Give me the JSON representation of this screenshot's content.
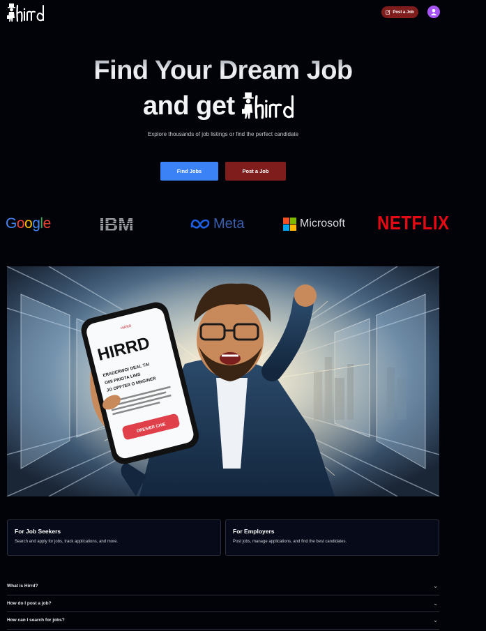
{
  "header": {
    "logo_text": "Hird",
    "post_job_label": "Post a Job"
  },
  "hero": {
    "line1": "Find Your Dream Job",
    "line2_prefix": "and get",
    "logo_text": "Hird",
    "subtitle": "Explore thousands of job listings or find the perfect candidate",
    "find_jobs_label": "Find Jobs",
    "post_job_label": "Post a Job"
  },
  "companies": [
    "Google",
    "IBM",
    "Meta",
    "Microsoft",
    "NETFLIX"
  ],
  "banner": {
    "phone_title": "HIRRD",
    "phone_small": "HIRRD",
    "phone_line1": "ERADERWO! DEAL TAI",
    "phone_line2": "OIIII PRIOTA LIMS",
    "phone_line3": "JO OPFTER O MNGINER",
    "phone_button": "DRESIER CHIE"
  },
  "cards": [
    {
      "title": "For Job Seekers",
      "text": "Search and apply for jobs, track applications, and more."
    },
    {
      "title": "For Employers",
      "text": "Post jobs, manage applications, and find the best candidates."
    }
  ],
  "faq": [
    {
      "question": "What is Hirrd?"
    },
    {
      "question": "How do I post a job?"
    },
    {
      "question": "How can I search for jobs?"
    }
  ],
  "colors": {
    "accent_blue": "#3b82f6",
    "accent_red": "#7f1d1d",
    "avatar": "#a855f7",
    "background": "#020308"
  },
  "icons": {
    "post_job": "edit-square-icon",
    "avatar": "user-icon",
    "faq_toggle": "chevron-down-icon"
  }
}
